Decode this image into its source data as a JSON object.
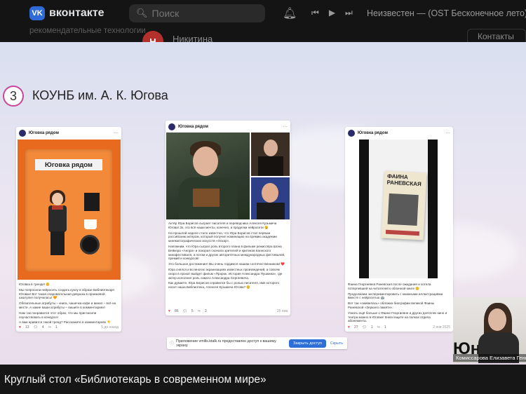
{
  "vk": {
    "logo_text": "VK",
    "brand": "вконтакте",
    "search_placeholder": "Поиск",
    "track": "Неизвестен — (OST Бесконечное лето)",
    "side_text": "рекомендательные технологии",
    "user_initial": "Н",
    "user_name": "Никитина",
    "right_button": "Контакты"
  },
  "slide": {
    "number": "3",
    "title": "КОУНБ им. А. К. Югова"
  },
  "posts": [
    {
      "group": "Юговка рядом",
      "image_label": "Юговка рядом",
      "text": [
        "Юговка в тренде! 😊",
        "Мы попросили нейросеть создать куклу в образе Библиотекаря Юговки! Вот такая очаровательная девушка в оранжевой шкатулке получилась! 🧡",
        "Обязательные атрибуты – книга, чашечка кофе и винил – всё на месте. А какие ваши атрибуты – пишите в комментариях!",
        "Нам так понравился этот образ, что мы пригласили поучаствовать в конкурсе!",
        "А вам нравится такой тренд? Расскажите в комментариях 👇"
      ],
      "likes": "13",
      "comments": "4",
      "reposts": "1",
      "date": "5 дн назад"
    },
    {
      "group": "Юговка рядом",
      "text": [
        "Актёр Юра Борисов сыграет писателя и переводчика Алексея Кузьмича Югова! Зх, это всё наши мечты, конечно, и проделки нейросети 😉",
        "На прошлой неделе стало известно, что Юра Борисов стал первым российским актером, который получил номинацию на премию академии кинематографических искусств «Оскар».",
        "Напомним, что Юра сыграл роль второго плана в фильме режиссёра Шона Бейкера «Анора» и покорил сначала зрителей и критиков Каннского кинофестиваля, а потом и других авторитетных международных фестивалей, премий и конкурсов!",
        "Это большое достижение! Мы очень гордимся нашим соотечественником! ❤️",
        "Юра снялся и во многих экранизациях известных произведений, а совсем скоро в прокат выйдет фильм «Пророк. История Александра Пушкина», где актер исполнил роль самого Александра Сергеевича.",
        "Как думаете, Юра Борисов справился бы с ролью писателя, имя которого носит наша Библиотека, Алексея Кузьмича Югова? 😊"
      ],
      "likes": "86",
      "comments": "5",
      "reposts": "3",
      "date": "25 янв"
    },
    {
      "group": "Юговка рядом",
      "book_title": "ФАИНА РАНЕВСКАЯ",
      "text": [
        "Фаина Георгиевна Раневская после ожидания и хотела потерпевшей на читателей к облачной книге 😊",
        "Продолжаем экспериментировать с книжными иллюстрациями вместе с нейросетью 🤖",
        "Вот так «оживилась» обложка биографии великой Фаины Раневской «Зеркало памяти».",
        "Узнать ещё больше о Фаине Георгиевне и других деятелях кино и театра можно в Юговке! Книги ищите на полках отдела абонемента."
      ],
      "likes": "27",
      "comments": "1",
      "reposts": "1",
      "date": "2 янв 2025"
    }
  ],
  "notice": {
    "message": "Приложение vmills.ktalk.ru предоставлен доступ к вашему экрану.",
    "allow_label": "Закрыть доступ",
    "hide_label": "Скрыть"
  },
  "webcam": {
    "logo": "Юн",
    "participant": "Комиссарова Елизавета Геннадь..."
  },
  "caption": "Круглый стол «Библиотекарь в современном мире»"
}
